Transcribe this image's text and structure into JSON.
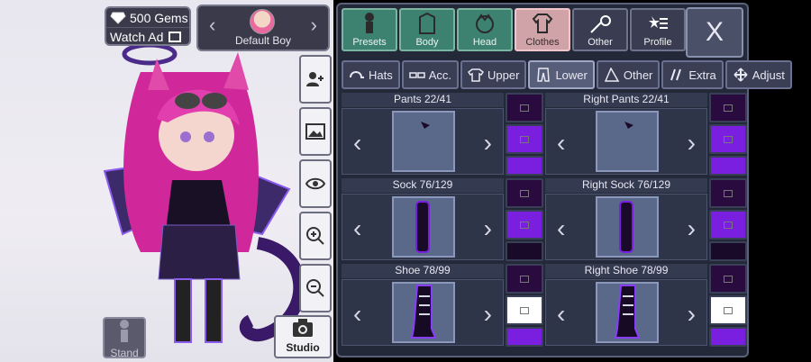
{
  "top": {
    "gems_label": "500 Gems",
    "watch_ad_label": "Watch Ad"
  },
  "character_select": {
    "name": "Default Boy",
    "prev_icon": "chevron-left-icon",
    "next_icon": "chevron-right-icon"
  },
  "side_buttons": [
    {
      "icon": "add-user-icon"
    },
    {
      "icon": "background-image-icon"
    },
    {
      "icon": "eye-icon"
    },
    {
      "icon": "zoom-in-icon"
    },
    {
      "icon": "zoom-out-icon"
    }
  ],
  "bottom_left": {
    "stand_label": "Stand",
    "studio_label": "Studio"
  },
  "categories": [
    {
      "label": "Presets",
      "icon": "presets-icon"
    },
    {
      "label": "Body",
      "icon": "body-icon"
    },
    {
      "label": "Head",
      "icon": "head-icon"
    },
    {
      "label": "Clothes",
      "icon": "shirt-icon",
      "active": true
    },
    {
      "label": "Other",
      "icon": "sword-cat-icon"
    },
    {
      "label": "Profile",
      "icon": "profile-icon"
    }
  ],
  "close_label": "X",
  "sub_tabs": [
    {
      "label": "Hats",
      "icon": "cap-icon"
    },
    {
      "label": "Acc.",
      "icon": "glasses-icon"
    },
    {
      "label": "Upper",
      "icon": "shirt-icon"
    },
    {
      "label": "Lower",
      "icon": "pants-icon",
      "active": true
    },
    {
      "label": "Other",
      "icon": "cape-icon"
    },
    {
      "label": "Extra",
      "icon": "slashes-icon"
    },
    {
      "label": "Adjust",
      "icon": "move-icon"
    }
  ],
  "slots": [
    {
      "title": "Pants 22/41"
    },
    {
      "title": "Right Pants 22/41"
    },
    {
      "title": "Sock 76/129"
    },
    {
      "title": "Right Sock 76/129"
    },
    {
      "title": "Shoe 78/99"
    },
    {
      "title": "Right Shoe 78/99"
    }
  ],
  "colors": {
    "purple": "#7a1fe0",
    "dark": "#2a0b3f",
    "white": "#ffffff",
    "active_tab": "#cfa3a7",
    "tab": "#3d8270"
  }
}
